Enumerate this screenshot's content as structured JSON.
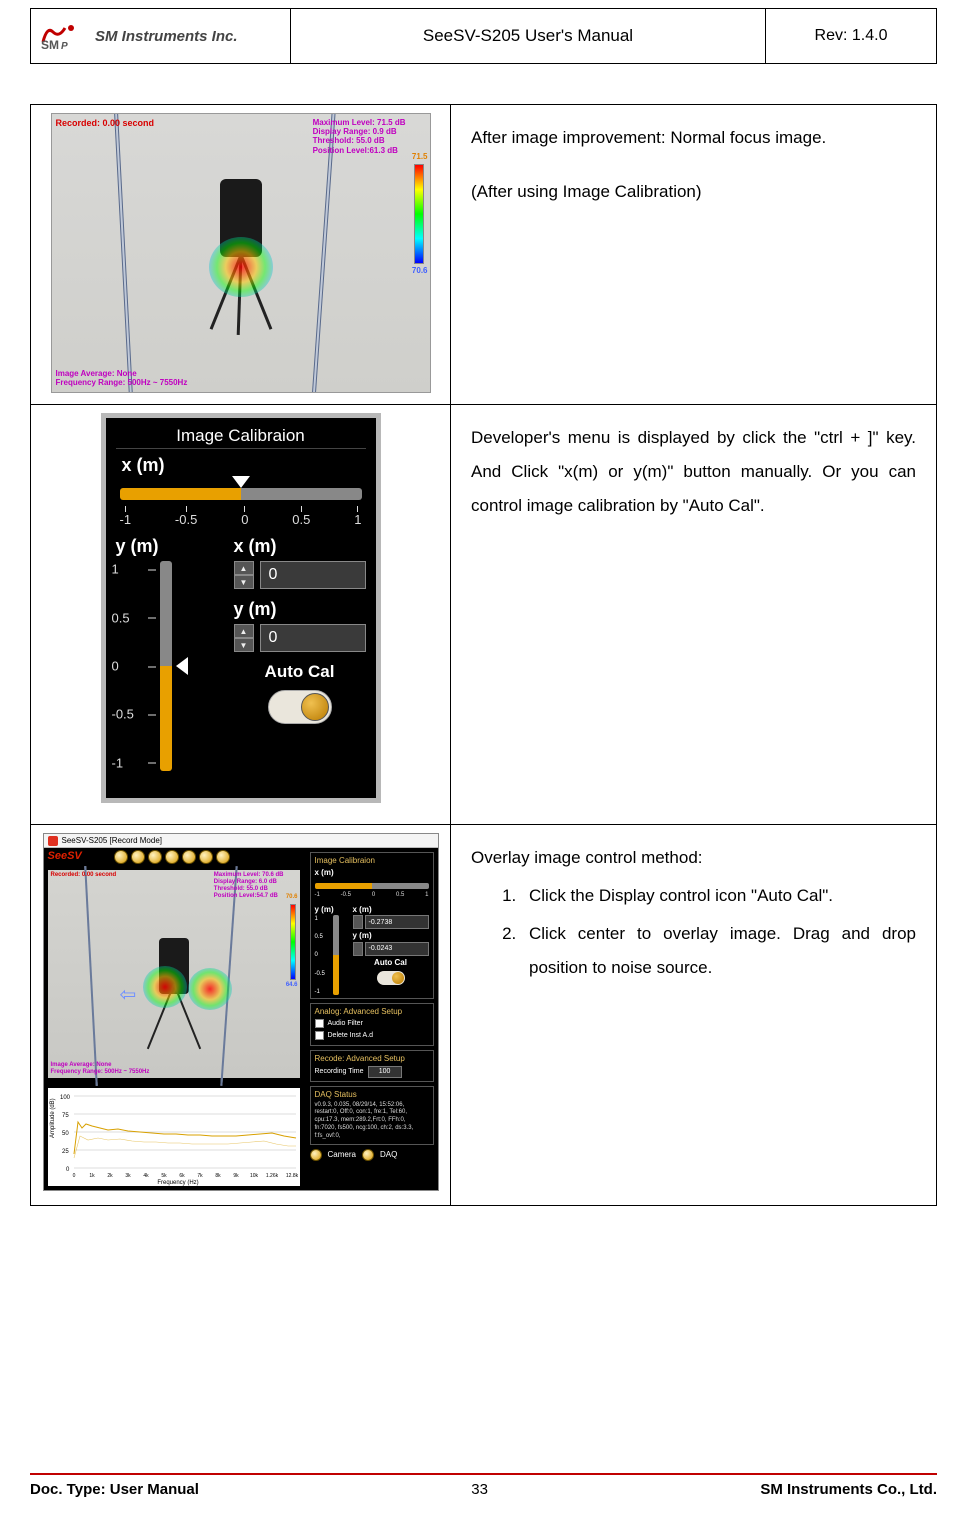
{
  "header": {
    "logo_text": "SM Instruments Inc.",
    "doc_title": "SeeSV-S205 User's Manual",
    "rev": "Rev: 1.4.0"
  },
  "row1": {
    "desc_line1": "After image improvement: Normal focus image.",
    "desc_line2": "(After using Image Calibration)",
    "screenshot": {
      "topleft": "Recorded: 0.00 second",
      "topright_l1": "Maximum Level: 71.5 dB",
      "topright_l2": "Display Range: 0.9 dB",
      "topright_l3": "Threshold: 55.0 dB",
      "topright_l4": "Position Level:61.3 dB",
      "cb_top": "71.5",
      "cb_bot": "70.6",
      "botleft_l1": "Image Average: None",
      "botleft_l2": "Frequency Range: 500Hz ~ 7550Hz"
    }
  },
  "row2": {
    "desc": "Developer's menu is displayed by click the \"ctrl + ]\" key. And Click \"x(m) or y(m)\" button manually. Or you can control image calibration by \"Auto Cal\".",
    "panel": {
      "title": "Image Calibraion",
      "xm_label": "x (m)",
      "ym_label": "y (m)",
      "hticks": {
        "t0": "-1",
        "t1": "-0.5",
        "t2": "0",
        "t3": "0.5",
        "t4": "1"
      },
      "vticks": {
        "t0": "1",
        "t1": "0.5",
        "t2": "0",
        "t3": "-0.5",
        "t4": "-1"
      },
      "x_value": "0",
      "y_value": "0",
      "autocal_label": "Auto Cal"
    }
  },
  "row3": {
    "desc_head": "Overlay image control method:",
    "desc_li1": "Click the Display control icon \"Auto Cal\".",
    "desc_li2": "Click center to overlay image. Drag and drop position to noise source.",
    "app": {
      "titlebar": "SeeSV-S205 [Record Mode]",
      "logo": "SeeSV",
      "cam": {
        "topleft": "Recorded: 0.00 second",
        "tr_l1": "Maximum Level: 70.6 dB",
        "tr_l2": "Display Range: 6.0 dB",
        "tr_l3": "Threshold: 55.0 dB",
        "tr_l4": "Position Level:54.7 dB",
        "cb_top": "70.6",
        "cb_bot": "64.6",
        "bl_l1": "Image Average: None",
        "bl_l2": "Frequency Range: 500Hz ~ 7550Hz"
      },
      "spectrum": {
        "ylabel": "Amplitude (dB)",
        "xlabel": "Frequency (Hz)",
        "yticks": {
          "y0": "100",
          "y1": "75",
          "y2": "50",
          "y3": "25",
          "y4": "0"
        },
        "xticks": {
          "x0": "0",
          "x1": "1k",
          "x2": "2k",
          "x3": "3k",
          "x4": "4k",
          "x5": "5k",
          "x6": "6k",
          "x7": "7k",
          "x8": "8k",
          "x9": "9k",
          "x10": "10k",
          "x11": "1.26k",
          "x12": "12.8k"
        }
      },
      "right": {
        "cal_title": "Image Calibraion",
        "xm": "x (m)",
        "ym": "y (m)",
        "x_val": "-0.2738",
        "y_val": "-0.0243",
        "autocal": "Auto Cal",
        "hticks": {
          "t0": "-1",
          "t1": "-0.5",
          "t2": "0",
          "t3": "0.5",
          "t4": "1"
        },
        "vticks": {
          "t0": "1",
          "t1": "0.5",
          "t2": "0",
          "t3": "-0.5",
          "t4": "-1"
        },
        "analog_title": "Analog: Advanced Setup",
        "chk1": "Audio Filter",
        "chk2": "Delete Inst A.d",
        "record_title": "Recode: Advanced Setup",
        "rec_label": "Recording Time",
        "rec_val": "100",
        "daq_title": "DAQ Status",
        "daq_text": "v0.9.3, 0.035, 08/29/14, 15:52:06,\nrestart:0, Off:0, con:1, fre:1, Tel:60,\ncpu:17.3, mem:289.2,Frt:0, FFh:0,\nfn:7020, fs500, ncg:100, ch:2, ds:3.3,\nf:fs_ovf:0,",
        "bot_cam": "Camera",
        "bot_daq": "DAQ"
      }
    }
  },
  "footer": {
    "doc_type": "Doc. Type: User Manual",
    "page": "33",
    "company": "SM Instruments Co., Ltd."
  },
  "chart_data": {
    "type": "line",
    "title": "",
    "xlabel": "Frequency (Hz)",
    "ylabel": "Amplitude (dB)",
    "ylim": [
      0,
      100
    ],
    "xlim": [
      0,
      12800
    ],
    "x": [
      0,
      500,
      1000,
      2000,
      3000,
      4000,
      5000,
      6000,
      7000,
      8000,
      9000,
      10000,
      11000,
      12000,
      12800
    ],
    "values": [
      20,
      62,
      58,
      55,
      53,
      50,
      48,
      47,
      46,
      45,
      44,
      43,
      45,
      46,
      42
    ]
  }
}
